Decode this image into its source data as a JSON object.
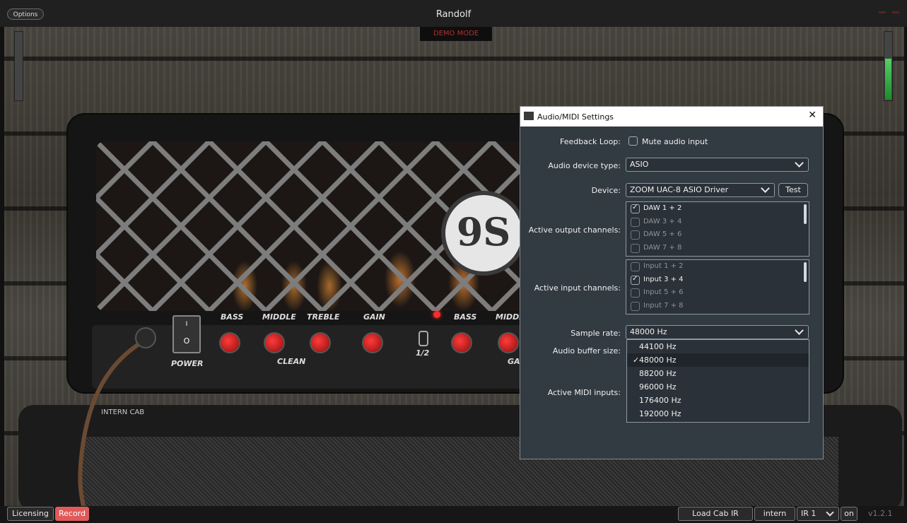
{
  "window": {
    "title": "Randolf",
    "options_label": "Options",
    "demo_label": "DEMO MODE"
  },
  "amp": {
    "power_label": "POWER",
    "power_on": "I",
    "power_off": "O",
    "knobs": [
      "BASS",
      "MIDDLE",
      "TREBLE",
      "GAIN",
      "BASS",
      "MIDDL"
    ],
    "clean_label": "CLEAN",
    "channel_switch_label": "1/2",
    "gain_partial": "GA",
    "logo_text": "9S",
    "cab_label": "INTERN CAB"
  },
  "meters": {
    "input_level": 0.0,
    "output_level": 0.6
  },
  "bottom": {
    "licensing": "Licensing",
    "record": "Record",
    "load_cab_ir": "Load Cab IR",
    "intern": "intern",
    "ir_select": "IR 1",
    "on": "on",
    "version": "v1.2.1"
  },
  "dialog": {
    "title": "Audio/MIDI Settings",
    "close": "✕",
    "feedback_loop_label": "Feedback Loop:",
    "mute_audio_input": "Mute audio input",
    "audio_device_type_label": "Audio device type:",
    "audio_device_type": "ASIO",
    "device_label": "Device:",
    "device": "ZOOM UAC-8 ASIO Driver",
    "test_label": "Test",
    "active_output_label": "Active output channels:",
    "output_channels": [
      {
        "label": "DAW 1 + 2",
        "checked": true
      },
      {
        "label": "DAW 3 + 4",
        "checked": false
      },
      {
        "label": "DAW 5 + 6",
        "checked": false
      },
      {
        "label": "DAW 7 + 8",
        "checked": false
      }
    ],
    "active_input_label": "Active input channels:",
    "input_channels": [
      {
        "label": "Input 1 + 2",
        "checked": false
      },
      {
        "label": "Input 3 + 4",
        "checked": true
      },
      {
        "label": "Input 5 + 6",
        "checked": false
      },
      {
        "label": "Input 7 + 8",
        "checked": false
      }
    ],
    "sample_rate_label": "Sample rate:",
    "sample_rate": "48000 Hz",
    "audio_buffer_label": "Audio buffer size:",
    "active_midi_label": "Active MIDI inputs:",
    "sample_rate_options": [
      "44100 Hz",
      "48000 Hz",
      "88200 Hz",
      "96000 Hz",
      "176400 Hz",
      "192000 Hz"
    ],
    "selected_option_mark": "✓"
  },
  "colors": {
    "dialog_bg": "#323a42",
    "record_bg": "#e05a5a",
    "meter_green": "#2ea83c",
    "demo_red": "#b43030"
  }
}
